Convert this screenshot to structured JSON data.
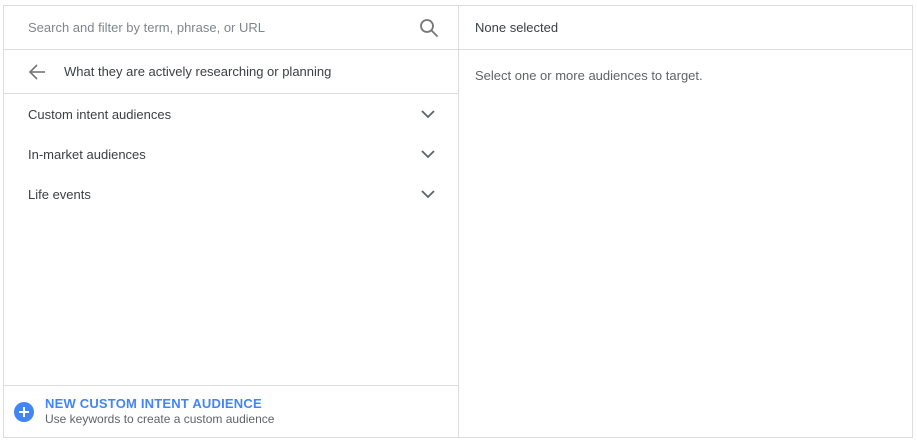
{
  "search": {
    "placeholder": "Search and filter by term, phrase, or URL",
    "value": "",
    "icon": "search-icon"
  },
  "category": {
    "back_icon": "arrow-back-icon",
    "title": "What they are actively researching or planning"
  },
  "list": {
    "items": [
      {
        "label": "Custom intent audiences",
        "icon": "chevron-down-icon"
      },
      {
        "label": "In-market audiences",
        "icon": "chevron-down-icon"
      },
      {
        "label": "Life events",
        "icon": "chevron-down-icon"
      }
    ]
  },
  "footer": {
    "icon": "add-circle-icon",
    "title": "NEW CUSTOM INTENT AUDIENCE",
    "subtitle": "Use keywords to create a custom audience"
  },
  "selected": {
    "header": "None selected",
    "empty_message": "Select one or more audiences to target."
  },
  "colors": {
    "accent": "#4285f4",
    "border": "#dadce0",
    "text": "#3c4043",
    "muted": "#5f6368",
    "icon": "#757575"
  }
}
